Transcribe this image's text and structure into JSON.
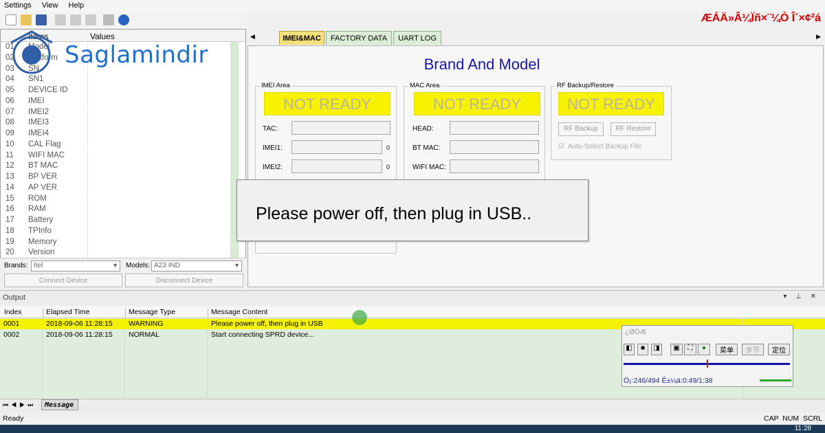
{
  "menu": [
    "Settings",
    "View",
    "Help"
  ],
  "window_title": "ÆÁÄ»Â¼Ïñ×¨¼Ò Î´×¢²á",
  "watermark": {
    "text": "Saglamindir"
  },
  "grid": {
    "header_items": "Items",
    "header_values": "Values",
    "rows": [
      {
        "idx": "01",
        "name": "Model"
      },
      {
        "idx": "02",
        "name": "Platform"
      },
      {
        "idx": "03",
        "name": "SN"
      },
      {
        "idx": "04",
        "name": "SN1"
      },
      {
        "idx": "05",
        "name": "DEVICE ID"
      },
      {
        "idx": "06",
        "name": "IMEI"
      },
      {
        "idx": "07",
        "name": "IMEI2"
      },
      {
        "idx": "08",
        "name": "IMEI3"
      },
      {
        "idx": "09",
        "name": "IMEI4"
      },
      {
        "idx": "10",
        "name": "CAL Flag"
      },
      {
        "idx": "11",
        "name": "WIFI MAC"
      },
      {
        "idx": "12",
        "name": "BT MAC"
      },
      {
        "idx": "13",
        "name": "BP VER"
      },
      {
        "idx": "14",
        "name": "AP VER"
      },
      {
        "idx": "15",
        "name": "ROM"
      },
      {
        "idx": "16",
        "name": "RAM"
      },
      {
        "idx": "17",
        "name": "Battery"
      },
      {
        "idx": "18",
        "name": "TPInfo"
      },
      {
        "idx": "19",
        "name": "Memory"
      },
      {
        "idx": "20",
        "name": "Version"
      }
    ]
  },
  "brands": {
    "label": "Brands:",
    "value": "Itel"
  },
  "models": {
    "label": "Models:",
    "value": "A23 IND"
  },
  "connect_btn": "Connect Device",
  "disconnect_btn": "Disconnect Device",
  "tabs": [
    "IMEI&MAC",
    "FACTORY DATA",
    "UART LOG"
  ],
  "main_title": "Brand And Model",
  "imei_area": {
    "label": "IMEI Area",
    "status": "NOT READY",
    "tac": "TAC:",
    "imei1": "IMEI1:",
    "imei1_val": "0",
    "imei2": "IMEI2:",
    "imei2_val": "0"
  },
  "mac_area": {
    "label": "MAC Area",
    "status": "NOT READY",
    "head": "HEAD:",
    "bt_mac": "BT MAC:",
    "wifi_mac": "WIFI MAC:"
  },
  "rf_area": {
    "label": "RF Backup/Restore",
    "status": "NOT READY",
    "backup": "RF Backup",
    "restore": "RF Restore",
    "auto_select": "Auto-Select Backup File"
  },
  "dialog_msg": "Please power off, then plug in USB..",
  "output": {
    "title": "Output",
    "columns": [
      "Index",
      "Elapsed Time",
      "Message Type",
      "Message Content"
    ],
    "rows": [
      {
        "index": "0001",
        "time": "2018-09-06 11:28:15",
        "type": "WARNING",
        "content": "Please power off, then plug in USB"
      },
      {
        "index": "0002",
        "time": "2018-09-06 11:28:15",
        "type": "NORMAL",
        "content": "Start connecting SPRD device..."
      }
    ]
  },
  "message_tab": "Message",
  "status": {
    "ready": "Ready",
    "indicators": "CAP  NUM  SCRL"
  },
  "player": {
    "title": "¿ØÖÆ",
    "btn_menu": "菜单",
    "btn_step": "步节",
    "btn_locate": "定位",
    "info": "Ö¡:246/494 Ê±¼ä:0:49/1:38",
    "progress": 0.498
  },
  "clock": "11:28",
  "colors": {
    "warning": "#f4f200",
    "accent": "#1818a8",
    "brand": "#1e6fd0"
  }
}
